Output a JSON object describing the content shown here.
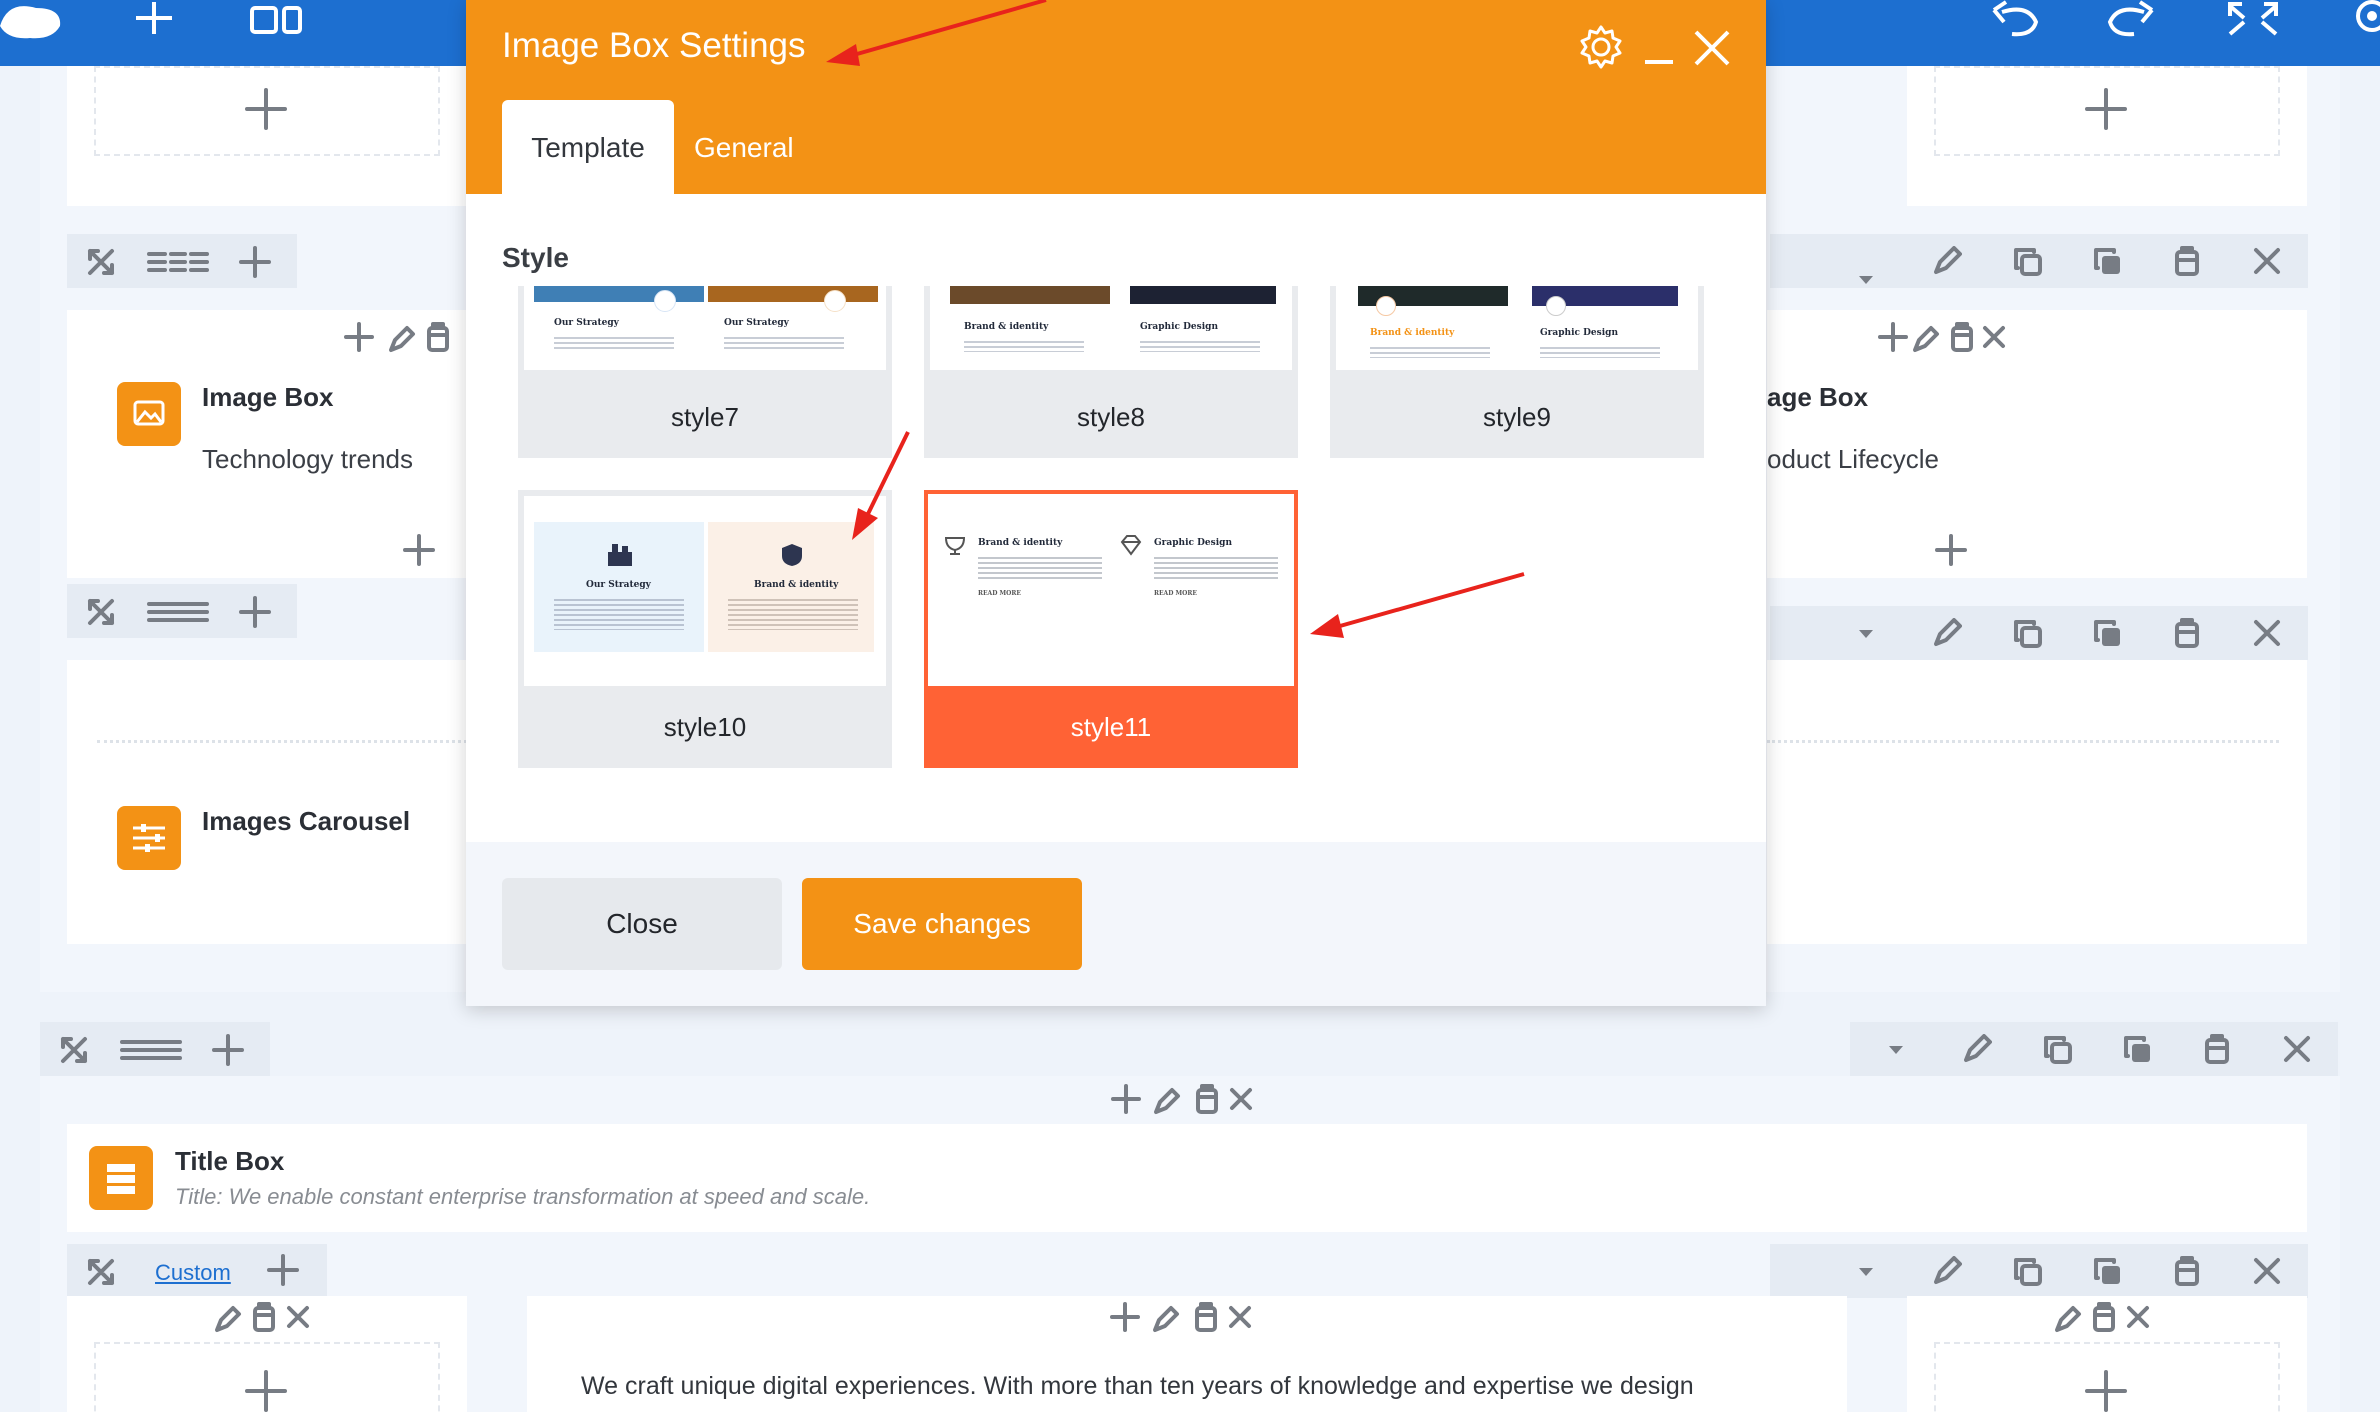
{
  "colors": {
    "blue_bar": "#1d6fd0",
    "orange": "#f39215",
    "selected": "#ff6235"
  },
  "topbar": {
    "icons": [
      "cloud-icon",
      "add-icon",
      "layout-icon",
      "undo-icon",
      "redo-icon",
      "fullscreen-icon",
      "settings-icon"
    ]
  },
  "background": {
    "image_box_left": {
      "title": "Image Box",
      "subtitle": "Technology trends"
    },
    "image_box_right": {
      "title": "age Box",
      "subtitle": "oduct Lifecycle"
    },
    "images_carousel": {
      "title": "Images Carousel"
    },
    "title_box": {
      "title": "Title Box",
      "subtitle": "Title: We enable constant enterprise transformation at speed and scale."
    },
    "custom_link": "Custom",
    "body_text": "We craft unique digital experiences. With more than ten years of knowledge and expertise we design"
  },
  "modal": {
    "title": "Image Box Settings",
    "tabs": [
      {
        "label": "Template",
        "active": true
      },
      {
        "label": "General",
        "active": false
      }
    ],
    "style_heading": "Style",
    "styles": [
      {
        "label": "style7",
        "selected": false
      },
      {
        "label": "style8",
        "selected": false
      },
      {
        "label": "style9",
        "selected": false
      },
      {
        "label": "style10",
        "selected": false
      },
      {
        "label": "style11",
        "selected": true
      }
    ],
    "thumbs": {
      "style7": {
        "left": "Our Strategy",
        "right": "Our Strategy"
      },
      "style8": {
        "left": "Brand & identity",
        "right": "Graphic Design"
      },
      "style9": {
        "left": "Brand & identity",
        "right": "Graphic Design"
      },
      "style10": {
        "left": "Our Strategy",
        "right": "Brand & identity"
      },
      "style11": {
        "left": "Brand & identity",
        "right": "Graphic Design",
        "more": "READ MORE"
      }
    },
    "buttons": {
      "close": "Close",
      "save": "Save changes"
    }
  }
}
